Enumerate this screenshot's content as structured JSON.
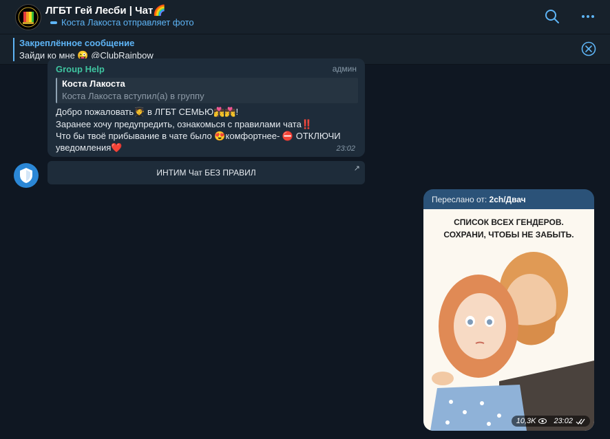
{
  "header": {
    "title": "ЛГБТ Гей Лесби | Чат🌈",
    "status": "Коста Лакоста отправляет фото"
  },
  "pinned": {
    "title": "Закреплённое сообщение",
    "text": "Зайди ко мне 😜 @ClubRainbow"
  },
  "message1": {
    "sender": "Group Help",
    "role": "админ",
    "quote_name": "Коста Лакоста",
    "quote_text": "Коста Лакоста вступил(а) в группу",
    "line1": "Добро пожаловать🧑‍🎓 в ЛГБТ СЕМЬЮ👩‍❤️‍💋‍👨👨‍❤️‍💋‍👨!",
    "line2": "Заранее хочу предупредить, ознакомься с правилами чата‼️",
    "line3": "Что бы твоё прибывание в чате было 😍комфортнее- ⛔ ОТКЛЮЧИ",
    "line4": "уведомления❤️",
    "time": "23:02"
  },
  "inline_button": {
    "label": "ИНТИМ Чат БЕЗ ПРАВИЛ",
    "arrow": "↗"
  },
  "forwarded": {
    "prefix": "Переслано от: ",
    "source": "2ch/Двач",
    "caption_line1": "СПИСОК ВСЕХ ГЕНДЕРОВ.",
    "caption_line2": "СОХРАНИ, ЧТОБЫ НЕ ЗАБЫТЬ.",
    "views": "10,3K",
    "time": "23:02"
  },
  "colors": {
    "accent": "#5eb5f7",
    "sender": "#3fc4a0",
    "outgoing_bubble": "#2b5278",
    "incoming_bubble": "#1e2c3a"
  }
}
